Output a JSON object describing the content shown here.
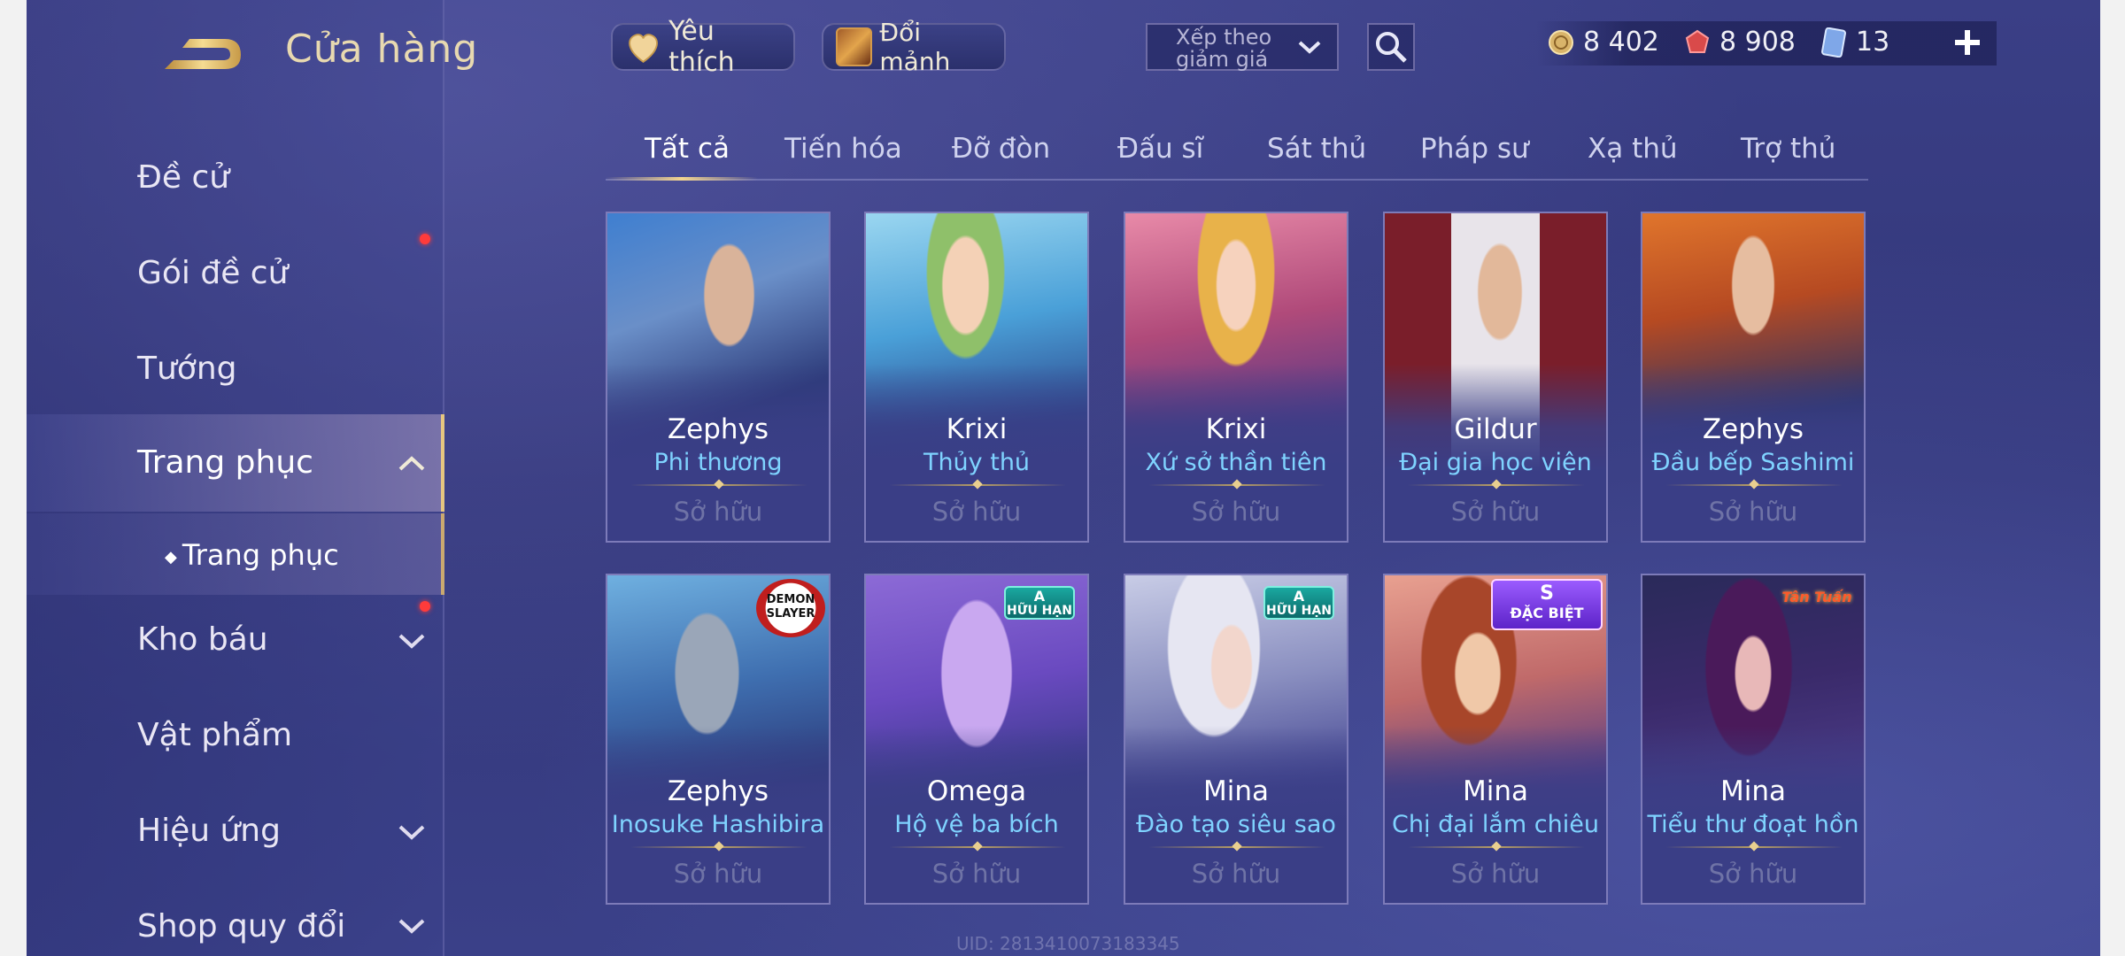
{
  "header": {
    "title": "Cửa hàng",
    "favorites_label": "Yêu thích",
    "shard_exchange_label": "Đổi mảnh",
    "sort": {
      "line1": "Xếp theo",
      "line2": "giảm giá"
    }
  },
  "currency": {
    "gold": "8 402",
    "ruby": "8 908",
    "cards": "13"
  },
  "sidebar": {
    "items": [
      {
        "label": "Đề cử"
      },
      {
        "label": "Gói đề cử"
      },
      {
        "label": "Tướng"
      },
      {
        "label": "Trang phục"
      },
      {
        "label": "Kho báu"
      },
      {
        "label": "Vật phẩm"
      },
      {
        "label": "Hiệu ứng"
      },
      {
        "label": "Shop quy đổi"
      }
    ],
    "sub_item": "Trang phục"
  },
  "tabs": [
    "Tất cả",
    "Tiến hóa",
    "Đỡ đòn",
    "Đấu sĩ",
    "Sát thủ",
    "Pháp sư",
    "Xạ thủ",
    "Trợ thủ"
  ],
  "cards": [
    {
      "hero": "Zephys",
      "skin": "Phi thương",
      "status": "Sở hữu"
    },
    {
      "hero": "Krixi",
      "skin": "Thủy thủ",
      "status": "Sở hữu"
    },
    {
      "hero": "Krixi",
      "skin": "Xứ sở thần tiên",
      "status": "Sở hữu"
    },
    {
      "hero": "Gildur",
      "skin": "Đại gia học viện",
      "status": "Sở hữu"
    },
    {
      "hero": "Zephys",
      "skin": "Đầu bếp Sashimi",
      "status": "Sở hữu"
    },
    {
      "hero": "Zephys",
      "skin": "Inosuke Hashibira",
      "status": "Sở hữu",
      "badge": "DEMON SLAYER"
    },
    {
      "hero": "Omega",
      "skin": "Hộ vệ ba bích",
      "status": "Sở hữu",
      "badge": "A HỮU HẠN"
    },
    {
      "hero": "Mina",
      "skin": "Đào tạo siêu sao",
      "status": "Sở hữu",
      "badge": "A HỮU HẠN"
    },
    {
      "hero": "Mina",
      "skin": "Chị đại lắm chiêu",
      "status": "Sở hữu",
      "badge": "S ĐẶC BIỆT"
    },
    {
      "hero": "Mina",
      "skin": "Tiểu thư đoạt hồn",
      "status": "Sở hữu",
      "badge": "Tân Tuấn"
    }
  ],
  "badges": {
    "demon_slayer": [
      "DEMON",
      "SLAYER"
    ],
    "a_limited": [
      "A",
      "HỮU HẠN"
    ],
    "s_special": [
      "S",
      "ĐẶC BIỆT"
    ],
    "tan_tuan": "Tân Tuấn"
  },
  "uid": "UID: 2813410073183345",
  "icons": {
    "back": "back-arrow-icon",
    "favorite": "heart-icon",
    "shard": "shard-box-icon",
    "search": "search-icon",
    "gold": "gold-coin-icon",
    "ruby": "ruby-gem-icon",
    "card": "voucher-card-icon",
    "add": "plus-icon"
  },
  "colors": {
    "accent_gold": "#e6c680",
    "skin_name": "#7fd3ff",
    "notification": "#ff3b3b"
  }
}
